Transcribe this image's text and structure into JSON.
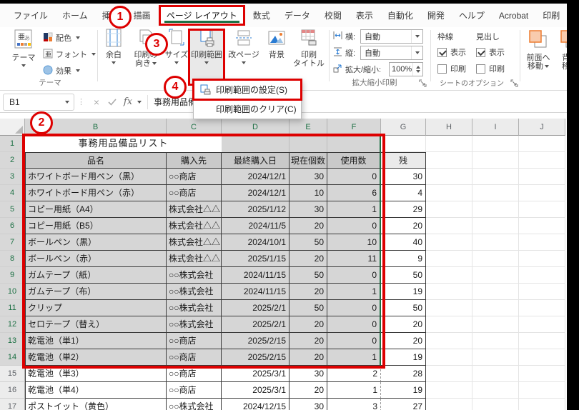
{
  "chrome": {
    "menu_tabs": [
      {
        "label": "ファイル",
        "sel": false
      },
      {
        "label": "ホーム",
        "sel": false
      },
      {
        "label": "挿入",
        "sel": false
      },
      {
        "label": "描画",
        "sel": false
      },
      {
        "label": "ページ レイアウト",
        "sel": true
      },
      {
        "label": "数式",
        "sel": false
      },
      {
        "label": "データ",
        "sel": false
      },
      {
        "label": "校閲",
        "sel": false
      },
      {
        "label": "表示",
        "sel": false
      },
      {
        "label": "自動化",
        "sel": false
      },
      {
        "label": "開発",
        "sel": false
      },
      {
        "label": "ヘルプ",
        "sel": false
      },
      {
        "label": "Acrobat",
        "sel": false
      },
      {
        "label": "印刷",
        "sel": false
      }
    ]
  },
  "ribbon": {
    "theme": {
      "main": "テーマ",
      "colors": "配色",
      "fonts": "フォント",
      "effects": "効果",
      "group_label": "テーマ"
    },
    "page_setup": {
      "margins": "余白",
      "orientation": "印刷の\n向き",
      "size": "サイズ",
      "print_area": "印刷範囲",
      "breaks": "改ページ",
      "background": "背景",
      "print_titles": "印刷\nタイトル"
    },
    "scale": {
      "width_label": "横:",
      "height_label": "縦:",
      "scale_label": "拡大/縮小:",
      "width_value": "自動",
      "height_value": "自動",
      "scale_value": "100%",
      "group_label": "拡大縮小印刷"
    },
    "sheet_options": {
      "gridlines": "枠線",
      "headings": "見出し",
      "view": "表示",
      "print": "印刷",
      "group_label": "シートのオプション"
    },
    "arrange": {
      "bring_forward": "前面へ\n移動",
      "send_backward": "背面\n移動"
    }
  },
  "print_area_menu": {
    "set": "印刷範囲の設定(S)",
    "clear": "印刷範囲のクリア(C)"
  },
  "formula_bar": {
    "name_box": "B1",
    "fx": "fx",
    "value": "事務用品備品リスト"
  },
  "annotations": {
    "accent": "#dd0000",
    "n1": "1",
    "n2": "2",
    "n3": "3",
    "n4": "4"
  },
  "sheet": {
    "col_letters": [
      "B",
      "C",
      "D",
      "E",
      "F",
      "G",
      "H",
      "I",
      "J"
    ],
    "title": "事務用品備品リスト",
    "headers": [
      "品名",
      "購入先",
      "最終購入日",
      "現在個数",
      "使用数",
      "残"
    ],
    "rows": [
      {
        "n": 3,
        "name": "ホワイトボード用ペン（黒）",
        "supplier": "○○商店",
        "date": "2024/12/1",
        "qty": "30",
        "used": "0",
        "remain": "30",
        "sel": true
      },
      {
        "n": 4,
        "name": "ホワイトボード用ペン（赤）",
        "supplier": "○○商店",
        "date": "2024/12/1",
        "qty": "10",
        "used": "6",
        "remain": "4",
        "sel": true
      },
      {
        "n": 5,
        "name": "コピー用紙（A4）",
        "supplier": "株式会社△△",
        "date": "2025/1/12",
        "qty": "30",
        "used": "1",
        "remain": "29",
        "sel": true
      },
      {
        "n": 6,
        "name": "コピー用紙（B5）",
        "supplier": "株式会社△△",
        "date": "2024/11/5",
        "qty": "20",
        "used": "0",
        "remain": "20",
        "sel": true
      },
      {
        "n": 7,
        "name": "ボールペン（黒）",
        "supplier": "株式会社△△",
        "date": "2024/10/1",
        "qty": "50",
        "used": "10",
        "remain": "40",
        "sel": true
      },
      {
        "n": 8,
        "name": "ボールペン（赤）",
        "supplier": "株式会社△△",
        "date": "2025/1/15",
        "qty": "20",
        "used": "11",
        "remain": "9",
        "sel": true
      },
      {
        "n": 9,
        "name": "ガムテープ（紙）",
        "supplier": "○○株式会社",
        "date": "2024/11/15",
        "qty": "50",
        "used": "0",
        "remain": "50",
        "sel": true
      },
      {
        "n": 10,
        "name": "ガムテープ（布）",
        "supplier": "○○株式会社",
        "date": "2024/11/15",
        "qty": "20",
        "used": "1",
        "remain": "19",
        "sel": true
      },
      {
        "n": 11,
        "name": "クリップ",
        "supplier": "○○株式会社",
        "date": "2025/2/1",
        "qty": "50",
        "used": "0",
        "remain": "50",
        "sel": true
      },
      {
        "n": 12,
        "name": "セロテープ（替え）",
        "supplier": "○○株式会社",
        "date": "2025/2/1",
        "qty": "20",
        "used": "0",
        "remain": "20",
        "sel": true
      },
      {
        "n": 13,
        "name": "乾電池（単1）",
        "supplier": "○○商店",
        "date": "2025/2/15",
        "qty": "20",
        "used": "0",
        "remain": "20",
        "sel": true
      },
      {
        "n": 14,
        "name": "乾電池（単2）",
        "supplier": "○○商店",
        "date": "2025/2/15",
        "qty": "20",
        "used": "1",
        "remain": "19",
        "sel": true
      },
      {
        "n": 15,
        "name": "乾電池（単3）",
        "supplier": "○○商店",
        "date": "2025/3/1",
        "qty": "30",
        "used": "2",
        "remain": "28",
        "sel": false
      },
      {
        "n": 16,
        "name": "乾電池（単4）",
        "supplier": "○○商店",
        "date": "2025/3/1",
        "qty": "20",
        "used": "1",
        "remain": "19",
        "sel": false
      },
      {
        "n": 17,
        "name": "ポストイット（黄色）",
        "supplier": "○○株式会社",
        "date": "2024/12/15",
        "qty": "30",
        "used": "3",
        "remain": "27",
        "sel": false
      }
    ]
  }
}
